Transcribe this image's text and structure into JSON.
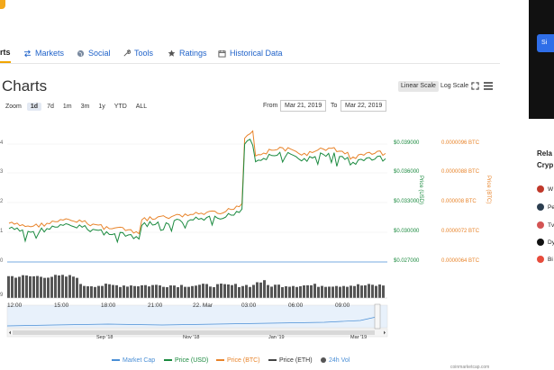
{
  "tabs": [
    {
      "label": "rts",
      "icon": "none",
      "active": true
    },
    {
      "label": "Markets",
      "icon": "arrows-exchange-icon",
      "active": false
    },
    {
      "label": "Social",
      "icon": "globe-icon",
      "active": false
    },
    {
      "label": "Tools",
      "icon": "wrench-icon",
      "active": false
    },
    {
      "label": "Ratings",
      "icon": "star-icon",
      "active": false
    },
    {
      "label": "Historical Data",
      "icon": "calendar-icon",
      "active": false
    }
  ],
  "page_title": "Charts",
  "scale": {
    "linear": "Linear Scale",
    "log": "Log Scale"
  },
  "zoom": {
    "label": "Zoom",
    "options": [
      "1d",
      "7d",
      "1m",
      "3m",
      "1y",
      "YTD",
      "ALL"
    ],
    "selected": "1d"
  },
  "range": {
    "from_label": "From",
    "from": "Mar 21, 2019",
    "to_label": "To",
    "to": "Mar 22, 2019"
  },
  "axes": {
    "left_ticks": [
      "4",
      "3",
      "2",
      "1",
      "0",
      "9"
    ],
    "usd_ticks": [
      "$0.039000",
      "$0.036000",
      "$0.033000",
      "$0.030000",
      "$0.027000"
    ],
    "btc_ticks": [
      "0.0000096 BTC",
      "0.0000088 BTC",
      "0.000008 BTC",
      "0.0000072 BTC",
      "0.0000064 BTC"
    ],
    "usd_title": "Price (USD)",
    "btc_title": "Price (BTC)",
    "x_ticks": [
      "12:00",
      "15:00",
      "18:00",
      "21:00",
      "22. Mar",
      "03:00",
      "06:00",
      "09:00"
    ],
    "nav_ticks": [
      "Sep '18",
      "Nov '18",
      "Jan '19",
      "Mar '19"
    ]
  },
  "legend": [
    {
      "label": "Market Cap",
      "color": "#4a8fd6",
      "kind": "line"
    },
    {
      "label": "Price (USD)",
      "color": "#1b8a3f",
      "kind": "line"
    },
    {
      "label": "Price (BTC)",
      "color": "#e8842b",
      "kind": "line"
    },
    {
      "label": "Price (ETH)",
      "color": "#444444",
      "kind": "line"
    },
    {
      "label": "24h Vol",
      "color": "#555555",
      "kind": "dot"
    }
  ],
  "colors": {
    "usd": "#1b8a3f",
    "btc": "#e8842b",
    "marketcap": "#4a8fd6",
    "accent": "#f1a500",
    "link": "#1f62c9"
  },
  "footer": "coinmarketcap.com",
  "sidebar": {
    "signup": "Si",
    "title_line1": "Rela",
    "title_line2": "Cryp",
    "items": [
      {
        "label": "W",
        "icon": "coin-w-icon",
        "color": "#c0392b"
      },
      {
        "label": "Pe",
        "icon": "coin-pe-icon",
        "color": "#2c3e50"
      },
      {
        "label": "Tv",
        "icon": "coin-tv-icon",
        "color": "#d35454"
      },
      {
        "label": "Dy",
        "icon": "coin-dy-icon",
        "color": "#111111"
      },
      {
        "label": "Bi",
        "icon": "coin-bi-icon",
        "color": "#e74c3c"
      }
    ]
  }
}
